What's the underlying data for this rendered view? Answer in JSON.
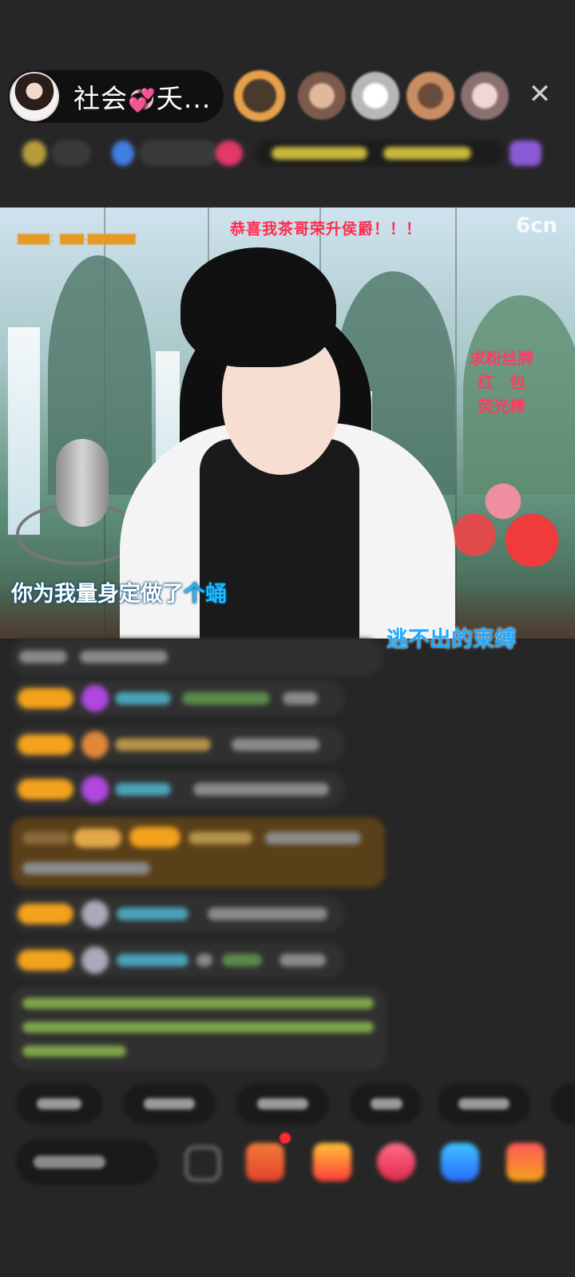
{
  "header": {
    "host_name": "社会",
    "host_name_heart": "💞",
    "host_name_suffix": "夭...",
    "close_label": "✕",
    "viewer_avatars": [
      "viewer-1",
      "viewer-2",
      "viewer-3",
      "viewer-4",
      "viewer-5"
    ]
  },
  "video": {
    "congrats_text": "恭喜我茶哥荣升侯爵！！！",
    "watermark": "6cn",
    "request_lines": [
      "求粉丝牌",
      "红　包",
      "荧光棒"
    ],
    "lyric_line_1_a": "你为我量身定做了",
    "lyric_line_1_b": "个",
    "lyric_line_1_c": "蛹",
    "lyric_line_2": "逃不出的束缚"
  },
  "colors": {
    "accent_badge": "#f2a21c",
    "congrats_red": "#ff2b4d",
    "lyric_blue": "#1fb8ff",
    "background": "#262626"
  },
  "icons": [
    "close-icon",
    "gift-icon",
    "fan-badge-icon",
    "redpacket-icon",
    "chat-icon",
    "game-icon",
    "more-icon"
  ]
}
